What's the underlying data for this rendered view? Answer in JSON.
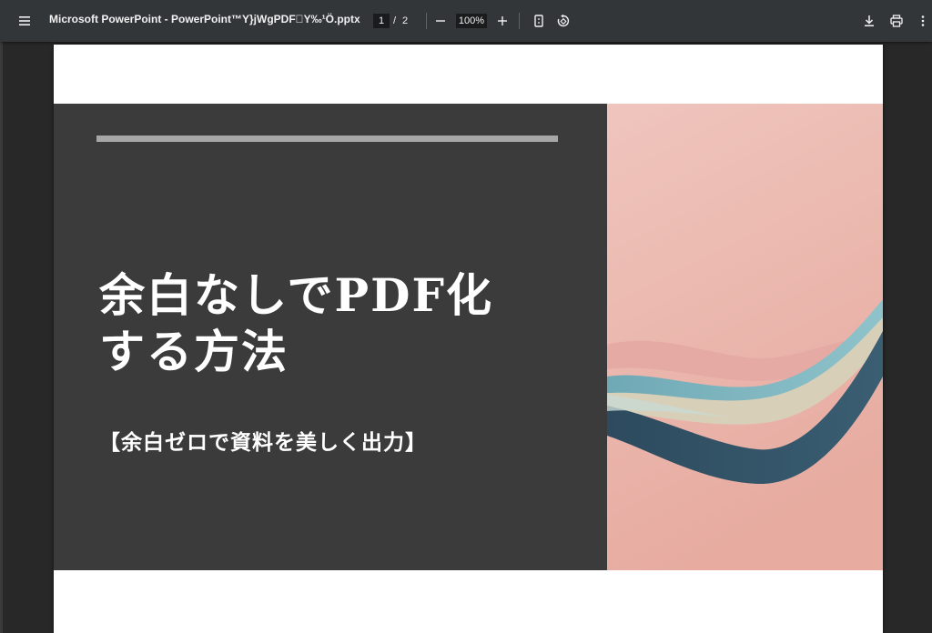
{
  "toolbar": {
    "menu_icon": "menu-icon",
    "title": "Microsoft PowerPoint - PowerPoint™Y}jWgPDF\u0000Y‰¹Ö.pptx",
    "page_current": "1",
    "page_separator": "/",
    "page_total": "2",
    "zoom_out_icon": "minus-icon",
    "zoom_value": "100%",
    "zoom_in_icon": "plus-icon",
    "fit_icon": "fit-page-icon",
    "rotate_icon": "rotate-icon",
    "download_icon": "download-icon",
    "print_icon": "print-icon",
    "more_icon": "more-vertical-icon"
  },
  "slide": {
    "title_line1": "余白なしでPDF化",
    "title_line2": "する方法",
    "subtitle": "【余白ゼロで資料を美しく出力】"
  },
  "colors": {
    "toolbar_bg": "#323639",
    "viewer_bg": "#282828",
    "slide_dark": "#3b3b3b",
    "accent_bar": "#a7a7a7",
    "image_bg": "#ecbcb2"
  }
}
